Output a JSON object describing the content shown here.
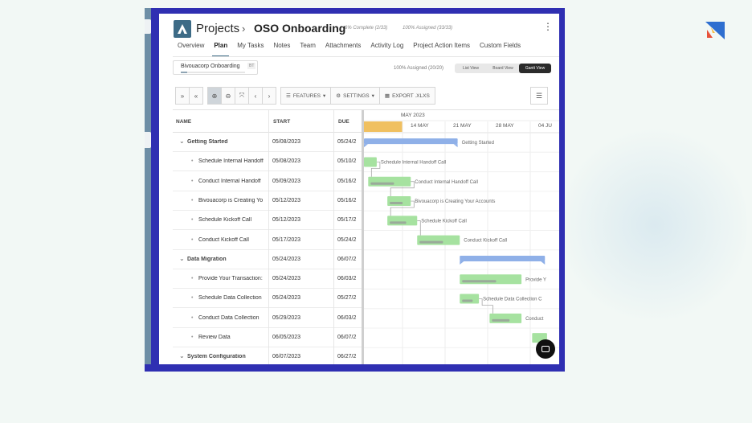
{
  "header": {
    "projects_label": "Projects",
    "separator": "›",
    "project_name": "OSO Onboarding",
    "complete_stat": "6% Complete (2/33)",
    "assigned_stat": "100% Assigned (33/33)",
    "more_icon": "kebab-icon"
  },
  "tabs": [
    "Overview",
    "Plan",
    "My Tasks",
    "Notes",
    "Team",
    "Attachments",
    "Activity Log",
    "Project Action Items",
    "Custom Fields"
  ],
  "active_tab": "Plan",
  "stakeholder": {
    "name": "Bivouacorp Onboarding",
    "badge": "BT",
    "progress": 0.1
  },
  "assigned_summary": "100% Assigned (20/20)",
  "views": [
    "List View",
    "Board View",
    "Gantt View"
  ],
  "active_view": "Gantt View",
  "toolbar": {
    "features_label": "FEATURES",
    "settings_label": "SETTINGS",
    "export_label": "EXPORT .XLXS"
  },
  "table": {
    "headers": {
      "name": "NAME",
      "start": "START",
      "due": "DUE"
    },
    "rows": [
      {
        "type": "group",
        "name": "Getting Started",
        "start": "05/08/2023",
        "due": "05/24/2"
      },
      {
        "type": "task",
        "name": "Schedule Internal Handoff",
        "start": "05/08/2023",
        "due": "05/10/2"
      },
      {
        "type": "task",
        "name": "Conduct Internal Handoff",
        "start": "05/09/2023",
        "due": "05/16/2"
      },
      {
        "type": "task",
        "name": "Bivouacorp is Creating Yo",
        "start": "05/12/2023",
        "due": "05/16/2"
      },
      {
        "type": "task",
        "name": "Schedule Kickoff Call",
        "start": "05/12/2023",
        "due": "05/17/2"
      },
      {
        "type": "task",
        "name": "Conduct Kickoff Call",
        "start": "05/17/2023",
        "due": "05/24/2"
      },
      {
        "type": "group",
        "name": "Data Migration",
        "start": "05/24/2023",
        "due": "06/07/2"
      },
      {
        "type": "task",
        "name": "Provide Your Transaction:",
        "start": "05/24/2023",
        "due": "06/03/2"
      },
      {
        "type": "task",
        "name": "Schedule Data Collection",
        "start": "05/24/2023",
        "due": "05/27/2"
      },
      {
        "type": "task",
        "name": "Conduct Data Collection",
        "start": "05/29/2023",
        "due": "06/03/2"
      },
      {
        "type": "task",
        "name": "Review Data",
        "start": "06/05/2023",
        "due": "06/07/2"
      },
      {
        "type": "group",
        "name": "System Configuration",
        "start": "06/07/2023",
        "due": "06/27/2"
      }
    ]
  },
  "gantt": {
    "month_label": "MAY 2023",
    "weeks": [
      "14 MAY",
      "21 MAY",
      "28 MAY",
      "04 JU"
    ],
    "bars": [
      {
        "label": "Getting Started",
        "kind": "group",
        "start": 0.0,
        "end": 2.2
      },
      {
        "label": "Schedule Internal Handoff Call",
        "kind": "task",
        "start": 0.0,
        "end": 0.3
      },
      {
        "label": "Conduct Internal Handoff Call",
        "kind": "task",
        "start": 0.1,
        "end": 1.1
      },
      {
        "label": "Bivouacorp is Creating Your Accounts",
        "kind": "task",
        "start": 0.55,
        "end": 1.1
      },
      {
        "label": "Schedule Kickoff Call",
        "kind": "task",
        "start": 0.55,
        "end": 1.25
      },
      {
        "label": "Conduct Kickoff Call",
        "kind": "task",
        "start": 1.25,
        "end": 2.25
      },
      {
        "label": "",
        "kind": "group",
        "start": 2.25,
        "end": 4.25
      },
      {
        "label": "Provide Y",
        "kind": "task",
        "start": 2.25,
        "end": 3.7
      },
      {
        "label": "Schedule Data Collection C",
        "kind": "task",
        "start": 2.25,
        "end": 2.7
      },
      {
        "label": "Conduct",
        "kind": "task",
        "start": 2.95,
        "end": 3.7
      },
      {
        "label": "",
        "kind": "task",
        "start": 3.95,
        "end": 4.3
      },
      {
        "label": "",
        "kind": "none",
        "start": 0,
        "end": 0
      }
    ],
    "colors": {
      "group": "#8fb0e8",
      "task": "#a6e2a0",
      "today": "#f0c060"
    }
  }
}
